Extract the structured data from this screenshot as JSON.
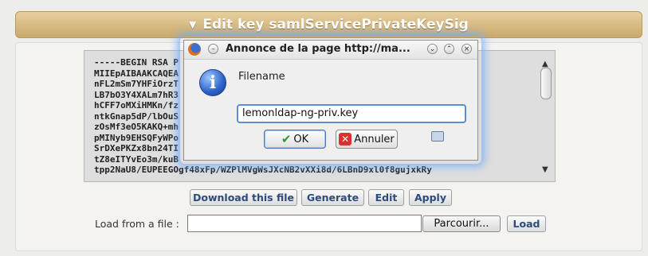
{
  "header": {
    "title": "Edit key samlServicePrivateKeySig"
  },
  "key_lines": [
    "-----BEGIN RSA P",
    "MIIEpAIBAAKCAQEA",
    "nFL2mSm7YHFiOrzT",
    "LB7bO3Y4XALm7hR3",
    "hCFF7oMXiHMKn/fz",
    "ntkGnap5dP/lbOuS",
    "zOsMf3eO5KAKQ+mh",
    "pMINyb9EHSQFyWPo",
    "SrDXePKZx8bn24TI",
    "tZ8eITYvEo3m/kuB",
    "tpp2NaU8/EUPEEGOgf48xFp/WZPlMVgWsJXcNB2vXXi8d/6LBnD9xl0f8gujxkRy"
  ],
  "buttons": {
    "download": "Download this file",
    "generate": "Generate",
    "edit": "Edit",
    "apply": "Apply",
    "browse": "Parcourir...",
    "load": "Load"
  },
  "load_label": "Load from a file :",
  "dialog": {
    "title": "Annonce de la page http://ma...",
    "message": "Filename",
    "input_value": "lemonldap-ng-priv.key",
    "ok_label": "OK",
    "cancel_label": "Annuler"
  },
  "icons": {
    "dialog": "firefox-icon",
    "info": "info-icon",
    "ok": "check-icon",
    "cancel": "cancel-icon"
  }
}
